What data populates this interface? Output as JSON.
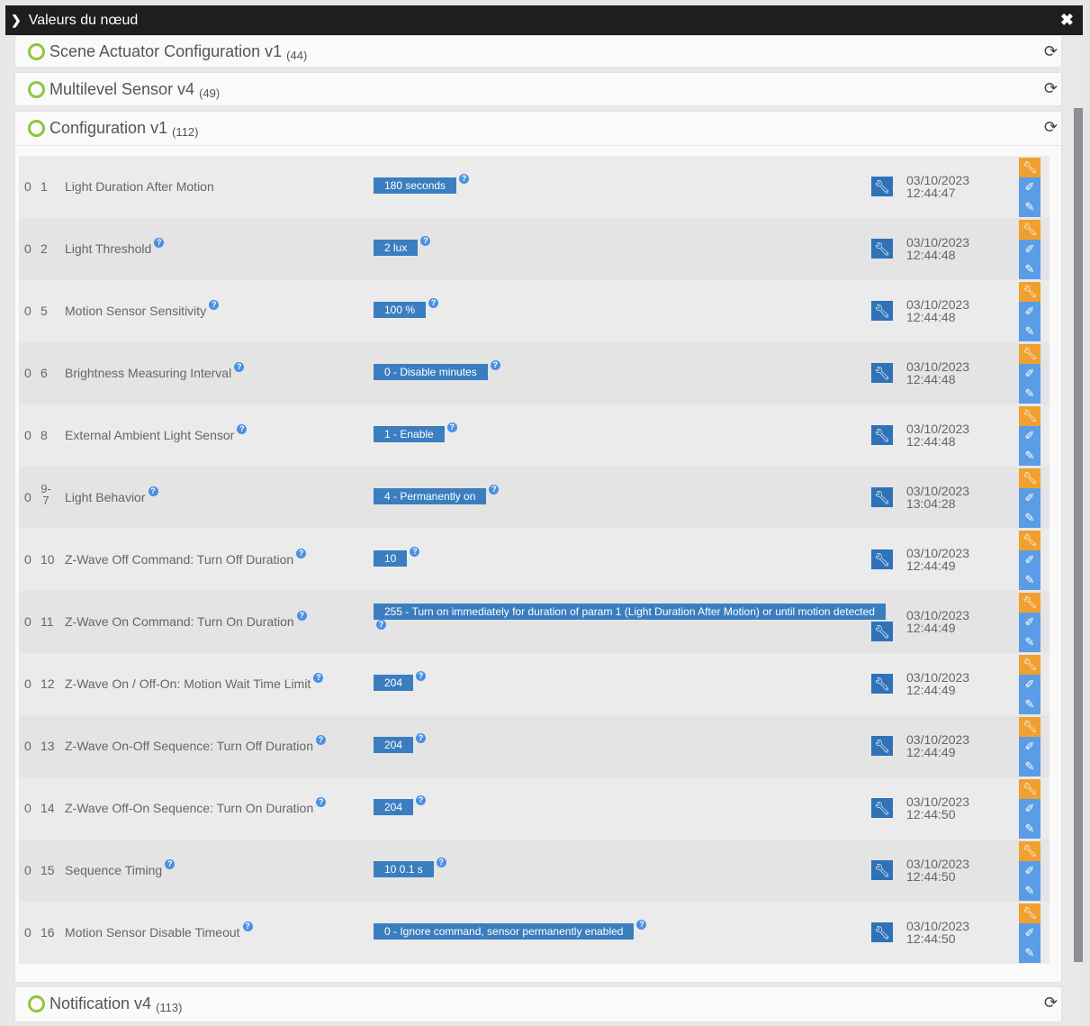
{
  "title": "Valeurs du nœud",
  "panels": [
    {
      "name": "Scene Actuator Configuration v1",
      "count": "(44)"
    },
    {
      "name": "Multilevel Sensor v4",
      "count": "(49)"
    },
    {
      "name": "Configuration v1",
      "count": "(112)"
    },
    {
      "name": "Notification v4",
      "count": "(113)"
    }
  ],
  "rows": [
    {
      "instance": "0",
      "index": "1",
      "name": "Light Duration After Motion",
      "value": "180 seconds",
      "date": "03/10/2023",
      "time": "12:44:47"
    },
    {
      "instance": "0",
      "index": "2",
      "name": "Light Threshold",
      "value": "2 lux",
      "date": "03/10/2023",
      "time": "12:44:48"
    },
    {
      "instance": "0",
      "index": "5",
      "name": "Motion Sensor Sensitivity",
      "value": "100 %",
      "date": "03/10/2023",
      "time": "12:44:48"
    },
    {
      "instance": "0",
      "index": "6",
      "name": "Brightness Measuring Interval",
      "value": "0 - Disable minutes",
      "date": "03/10/2023",
      "time": "12:44:48"
    },
    {
      "instance": "0",
      "index": "8",
      "name": "External Ambient Light Sensor",
      "value": "1 - Enable",
      "date": "03/10/2023",
      "time": "12:44:48"
    },
    {
      "instance": "0",
      "index": "9-7",
      "name": "Light Behavior",
      "value": "4 - Permanently on",
      "date": "03/10/2023",
      "time": "13:04:28"
    },
    {
      "instance": "0",
      "index": "10",
      "name": "Z-Wave Off Command: Turn Off Duration",
      "value": "10",
      "date": "03/10/2023",
      "time": "12:44:49"
    },
    {
      "instance": "0",
      "index": "11",
      "name": "Z-Wave On Command: Turn On Duration",
      "value": "255 - Turn on immediately for duration of param 1 (Light Duration After Motion) or until motion detected",
      "date": "03/10/2023",
      "time": "12:44:49"
    },
    {
      "instance": "0",
      "index": "12",
      "name": "Z-Wave On / Off-On: Motion Wait Time Limit",
      "value": "204",
      "date": "03/10/2023",
      "time": "12:44:49"
    },
    {
      "instance": "0",
      "index": "13",
      "name": "Z-Wave On-Off Sequence: Turn Off Duration",
      "value": "204",
      "date": "03/10/2023",
      "time": "12:44:49"
    },
    {
      "instance": "0",
      "index": "14",
      "name": "Z-Wave Off-On Sequence: Turn On Duration",
      "value": "204",
      "date": "03/10/2023",
      "time": "12:44:50"
    },
    {
      "instance": "0",
      "index": "15",
      "name": "Sequence Timing",
      "value": "10 0.1 s",
      "date": "03/10/2023",
      "time": "12:44:50"
    },
    {
      "instance": "0",
      "index": "16",
      "name": "Motion Sensor Disable Timeout",
      "value": "0 - Ignore command, sensor permanently enabled",
      "date": "03/10/2023",
      "time": "12:44:50"
    }
  ]
}
